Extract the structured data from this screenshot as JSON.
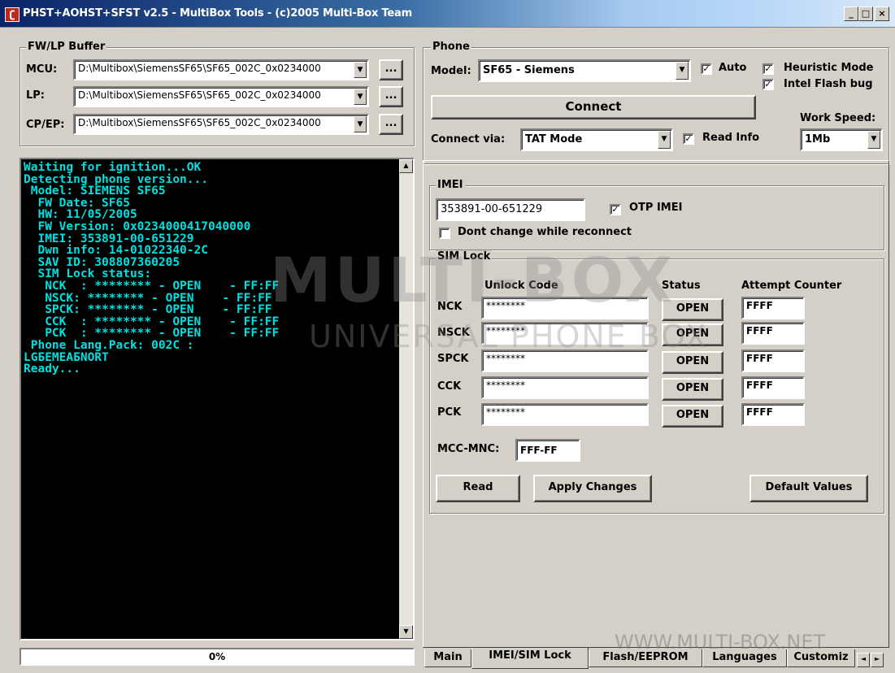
{
  "window": {
    "title": "PHST+AOHST+SFST v2.5 - MultiBox Tools - (c)2005 Multi-Box Team",
    "minimize_label": "_",
    "maximize_label": "□",
    "close_label": "×"
  },
  "fw_buffer": {
    "title": "FW/LP Buffer",
    "rows": [
      {
        "label": "MCU:",
        "value": "D:\\Multibox\\SiemensSF65\\SF65_002C_0x0234000",
        "browse": "..."
      },
      {
        "label": "LP:",
        "value": "D:\\Multibox\\SiemensSF65\\SF65_002C_0x0234000",
        "browse": "..."
      },
      {
        "label": "CP/EP:",
        "value": "D:\\Multibox\\SiemensSF65\\SF65_002C_0x0234000",
        "browse": "..."
      }
    ]
  },
  "phone": {
    "title": "Phone",
    "model_label": "Model:",
    "model_value": "SF65 - Siemens",
    "auto_label": "Auto",
    "auto_checked": "✓",
    "heuristic_label": "Heuristic Mode",
    "heuristic_checked": "✓",
    "intel_label": "Intel Flash bug",
    "intel_checked": "✓",
    "connect_label": "Connect",
    "work_speed_label": "Work Speed:",
    "connect_via_label": "Connect via:",
    "connect_via_value": "TAT Mode",
    "read_info_label": "Read Info",
    "read_info_checked": "✓",
    "speed_value": "1Mb"
  },
  "console": {
    "lines": [
      "Waiting for ignition...OK",
      "Detecting phone version...",
      " Model: SIEMENS SF65",
      "  FW Date: SF65",
      "  HW: 11/05/2005",
      "  FW Version: 0x0234000417040000",
      "  IMEI: 353891-00-651229",
      "  Dwn info: 14-01022340-2C",
      "  SAV ID: 308807360205",
      "  SIM Lock status:",
      "   NCK  : ******** - OPEN    - FF:FF",
      "   NSCK: ******** - OPEN    - FF:FF",
      "   SPCK: ******** - OPEN    - FF:FF",
      "   CCK  : ******** - OPEN    - FF:FF",
      "   PCK  : ******** - OPEN    - FF:FF",
      " Phone Lang.Pack: 002C :",
      "LGБEMEAБNORT",
      "Ready..."
    ],
    "progress": "0%"
  },
  "imei": {
    "title": "IMEI",
    "value": "353891-00-651229",
    "otp_label": "OTP IMEI",
    "otp_checked": "✓",
    "dont_change_label": "Dont change while reconnect"
  },
  "simlock": {
    "title": "SIM Lock",
    "col_code": "Unlock Code",
    "col_status": "Status",
    "col_attempt": "Attempt Counter",
    "rows": [
      {
        "name": "NCK",
        "code": "********",
        "status": "OPEN",
        "attempt": "FFFF"
      },
      {
        "name": "NSCK",
        "code": "********",
        "status": "OPEN",
        "attempt": "FFFF"
      },
      {
        "name": "SPCK",
        "code": "********",
        "status": "OPEN",
        "attempt": "FFFF"
      },
      {
        "name": "CCK",
        "code": "********",
        "status": "OPEN",
        "attempt": "FFFF"
      },
      {
        "name": "PCK",
        "code": "********",
        "status": "OPEN",
        "attempt": "FFFF"
      }
    ],
    "mcc_label": "MCC-MNC:",
    "mcc_value": "FFF-FF",
    "read_label": "Read",
    "apply_label": "Apply Changes",
    "default_label": "Default Values"
  },
  "tabs": [
    "Main",
    "IMEI/SIM Lock",
    "Flash/EEPROM",
    "Languages",
    "Customiz"
  ],
  "tab_scroll": {
    "left": "◄",
    "right": "►"
  },
  "watermark": {
    "logo": "MULTI-BOX",
    "sub": "UNIVERSAL PHONE BOX",
    "url": "WWW.MULTI-BOX.NET"
  }
}
